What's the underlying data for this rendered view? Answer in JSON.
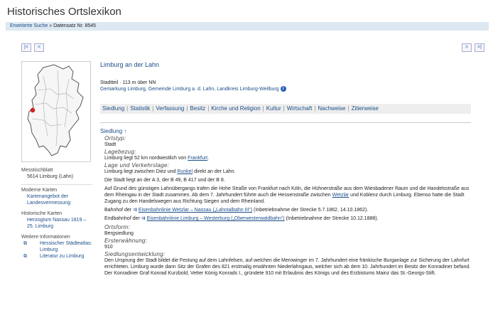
{
  "page": {
    "title": "Historisches Ortslexikon",
    "breadcrumb": {
      "link": "Erweiterte Suche",
      "sep": "»",
      "current": "Datensatz Nr. 8545"
    },
    "nav": {
      "first": "|<",
      "prev": "<",
      "next": ">",
      "last": ">|"
    }
  },
  "sidebar": {
    "messtisch_label": "Messtischblatt",
    "messtisch_value": "5614 Limburg (Lahn)",
    "moderne_label": "Moderne Karten",
    "moderne_link": "Kartenangebot der Landesvermessung",
    "hist_label": "Historische Karten",
    "hist_link": "Herzogtum Nassau 1819 – 25. Limburg",
    "weitere_label": "Weitere Informationen",
    "links": [
      "Hessischer Städteatlas: Limburg",
      "Literatur zu Limburg"
    ]
  },
  "main": {
    "heading": "Limburg an der Lahn",
    "info_line1": "Stadtteil · 113 m über NN",
    "info_line2": "Gemarkung Limburg, Gemeinde Limburg a. d. Lahn, Landkreis Limburg-Weilburg",
    "tabs": [
      "Siedlung",
      "Statistik",
      "Verfassung",
      "Besitz",
      "Kirche und Religion",
      "Kultur",
      "Wirtschaft",
      "Nachweise",
      "Zitierweise"
    ],
    "tab_sep": "|",
    "section": "Siedlung ↑",
    "ortstyp_label": "Ortstyp:",
    "ortstyp_value": "Stadt",
    "lage_label": "Lagebezug:",
    "lage_pre": "Limburg liegt 52 km nordwestlich von ",
    "lage_link": "Frankfurt",
    "lage_post": ".",
    "verkehr_label": "Lage und Verkehrslage:",
    "verkehr_1_pre": "Limburg liegt zwischen Diez und ",
    "verkehr_1_link": "Runkel",
    "verkehr_1_post": " direkt an der Lahn.",
    "verkehr_2": "Die Stadt liegt an der A 3, der B 49, B 417 und der B 8.",
    "verkehr_3_pre": "Auf Grund des günstigen Lahnübergangs trafen die Hohe Straße von Frankfurt nach Köln, die Hühnerstraße aus dem Wiesbadener Raum und die Handelsstraße aus dem Rheingau in der Stadt zusammen. Ab dem 7. Jahrhundert führte auch die Hessenstraße zwischen ",
    "verkehr_3_link": "Wetzlar",
    "verkehr_3_post": " und Koblenz durch Limburg. Ebenso hatte die Stadt Zugang zu den Handelswegen aus Richtung Siegen und dem Rheinland.",
    "bahn_1_pre": "Bahnhof der ",
    "bahn_1_link": "Eisenbahnlinie Wetzlar – Nassau („Lahntalbahn III“)",
    "bahn_1_post": " (Inbetriebnahme der Strecke 5.7.1862, 14.10.1862).",
    "bahn_2_pre": "Endbahnhof der ",
    "bahn_2_link": "Eisenbahnlinie Limburg – Westerburg („Oberwesterwaldbahn“)",
    "bahn_2_post": " (Inbetriebnahme der Strecke 10.12.1888).",
    "ortsform_label": "Ortsform:",
    "ortsform_value": "Bergsiedlung",
    "erst_label": "Ersterwähnung:",
    "erst_value": "910",
    "entw_label": "Siedlungsentwicklung:",
    "entw_text": "Den Ursprung der Stadt bildet die Festung auf dem Lahnfelsen, auf welchen die Merowinger im 7. Jahrhundert eine fränkische Burganlage zur Sicherung der Lahnfurt errichteten. Limburg wurde dann Sitz der Grafen des 821 erstmalig erwähnten Niederlahngaus, welcher sich ab dem 10. Jahrhundert im Besitz der Konradiner befand. Der Konradiner Graf Konrad Kurzbold, Vetter König Konrads I., gründete 910 mit Erlaubnis des Königs und des Erzbistums Mainz das St.-Georgs-Stift."
  },
  "colors": {
    "link": "#1c4e8a",
    "crumb_bg": "#dde8f2",
    "tab_bg": "#eeeeee",
    "marker": "#d22222"
  }
}
